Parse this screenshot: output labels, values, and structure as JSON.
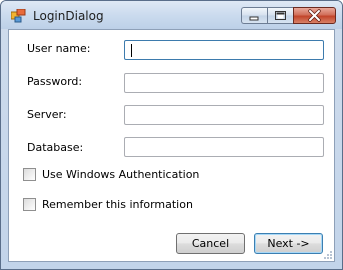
{
  "window": {
    "title": "LoginDialog"
  },
  "form": {
    "username_label": "User name:",
    "username_value": "",
    "password_label": "Password:",
    "password_value": "",
    "server_label": "Server:",
    "server_value": "",
    "database_label": "Database:",
    "database_value": ""
  },
  "options": {
    "windows_auth_label": "Use Windows Authentication",
    "windows_auth_checked": false,
    "remember_label": "Remember this information",
    "remember_checked": false
  },
  "buttons": {
    "cancel_label": "Cancel",
    "next_label": "Next ->"
  },
  "icons": {
    "app": "app-window-icon",
    "minimize": "minimize-icon",
    "maximize": "maximize-icon",
    "close": "close-icon",
    "grip": "resize-grip-icon"
  }
}
